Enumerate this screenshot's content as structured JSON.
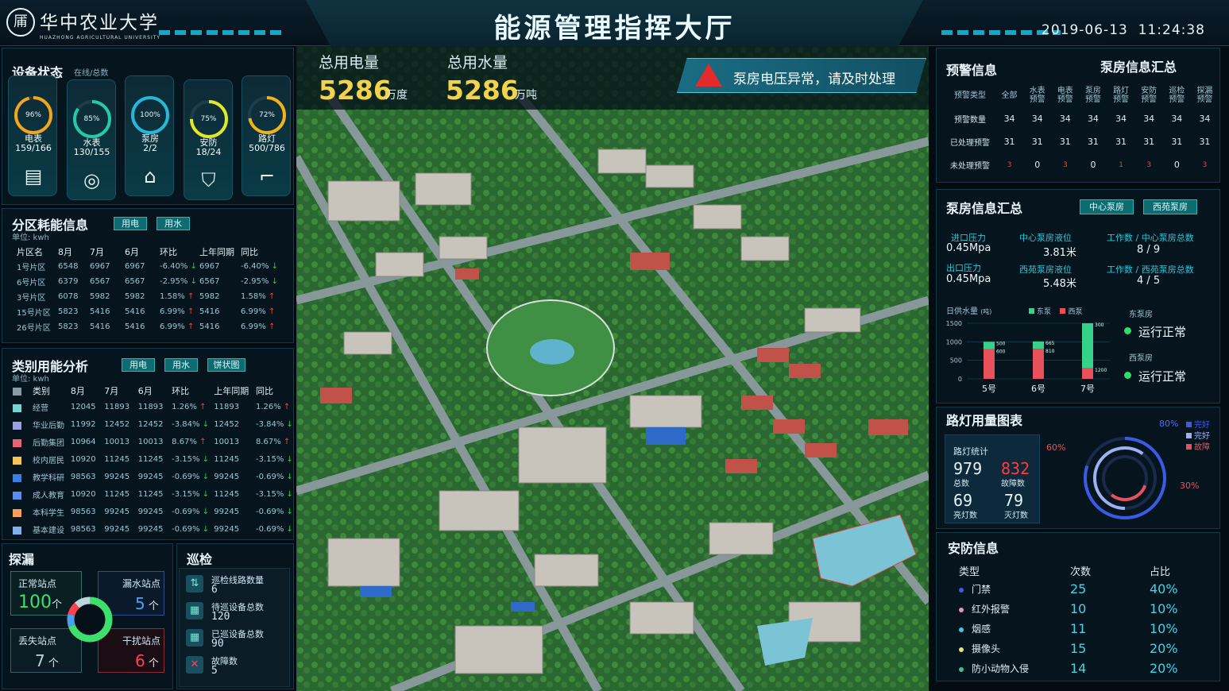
{
  "header": {
    "logo_glyph": "㕊",
    "logo_text": "华中农业大学",
    "logo_sub": "HUAZHONG AGRICULTURAL UNIVERSITY",
    "title": "能源管理指挥大厅",
    "date": "2019-06-13",
    "time": "11:24:38"
  },
  "device_status": {
    "title": "设备状态",
    "subtitle": "在线/总数",
    "items": [
      {
        "name": "电表",
        "pct": "96%",
        "count": "159/166",
        "level": 0.96,
        "color": "#f3a51d",
        "icon": "meter-icon",
        "glyph": "▤"
      },
      {
        "name": "水表",
        "pct": "85%",
        "count": "130/155",
        "level": 0.85,
        "color": "#26c9a8",
        "icon": "water-meter-icon",
        "glyph": "◎"
      },
      {
        "name": "泵房",
        "pct": "100%",
        "count": "2/2",
        "level": 1.0,
        "color": "#29b7d9",
        "icon": "house-icon",
        "glyph": "⌂"
      },
      {
        "name": "安防",
        "pct": "75%",
        "count": "18/24",
        "level": 0.75,
        "color": "#e2e72a",
        "icon": "shield-icon",
        "glyph": "⛉"
      },
      {
        "name": "路灯",
        "pct": "72%",
        "count": "500/786",
        "level": 0.72,
        "color": "#f1b21b",
        "icon": "streetlight-icon",
        "glyph": "⌐"
      }
    ]
  },
  "zone": {
    "title": "分区耗能信息",
    "unit": "单位: kwh",
    "tabs": [
      "用电",
      "用水"
    ],
    "headers": [
      "片区名",
      "8月",
      "7月",
      "6月",
      "环比",
      "上年同期",
      "同比"
    ],
    "rows": [
      [
        "1号片区",
        "6548",
        "6967",
        "6967",
        "-6.40%",
        "6967",
        "-6.40%",
        "dn",
        "dn"
      ],
      [
        "6号片区",
        "6379",
        "6567",
        "6567",
        "-2.95%",
        "6567",
        "-2.95%",
        "dn",
        "dn"
      ],
      [
        "3号片区",
        "6078",
        "5982",
        "5982",
        "1.58%",
        "5982",
        "1.58%",
        "up",
        "up"
      ],
      [
        "15号片区",
        "5823",
        "5416",
        "5416",
        "6.99%",
        "5416",
        "6.99%",
        "up",
        "up"
      ],
      [
        "26号片区",
        "5823",
        "5416",
        "5416",
        "6.99%",
        "5416",
        "6.99%",
        "up",
        "up"
      ]
    ]
  },
  "category": {
    "title": "类别用能分析",
    "unit": "单位: kwh",
    "tabs": [
      "用电",
      "用水",
      "饼状图"
    ],
    "headers": [
      "类别",
      "8月",
      "7月",
      "6月",
      "环比",
      "上年同期",
      "同比"
    ],
    "rows": [
      [
        "经营",
        "12045",
        "11893",
        "11893",
        "1.26%",
        "11893",
        "1.26%",
        "up",
        "#79d4d0"
      ],
      [
        "华业后勤",
        "11992",
        "12452",
        "12452",
        "-3.84%",
        "12452",
        "-3.84%",
        "dn",
        "#9aa2e0"
      ],
      [
        "后勤集团",
        "10964",
        "10013",
        "10013",
        "8.67%",
        "10013",
        "8.67%",
        "up",
        "#e2657a"
      ],
      [
        "校内居民",
        "10920",
        "11245",
        "11245",
        "-3.15%",
        "11245",
        "-3.15%",
        "dn",
        "#f2c45a"
      ],
      [
        "教学科研",
        "98563",
        "99245",
        "99245",
        "-0.69%",
        "99245",
        "-0.69%",
        "dn",
        "#3b7fe0"
      ],
      [
        "成人教育",
        "10920",
        "11245",
        "11245",
        "-3.15%",
        "11245",
        "-3.15%",
        "dn",
        "#5a8ce8"
      ],
      [
        "本科学生",
        "98563",
        "99245",
        "99245",
        "-0.69%",
        "99245",
        "-0.69%",
        "dn",
        "#f3a05a"
      ],
      [
        "基本建设",
        "98563",
        "99245",
        "99245",
        "-0.69%",
        "99245",
        "-0.69%",
        "dn",
        "#7fb0e8"
      ]
    ]
  },
  "leak": {
    "title": "探漏",
    "normal_label": "正常站点",
    "normal_val": "100",
    "leak_label": "漏水站点",
    "leak_val": "5",
    "lost_label": "丢失站点",
    "lost_val": "7",
    "interfere_label": "干扰站点",
    "interfere_val": "6",
    "unit": "个"
  },
  "patrol": {
    "title": "巡检",
    "items": [
      {
        "label": "巡检线路数量",
        "val": "6",
        "icon": "route-icon"
      },
      {
        "label": "待巡设备总数",
        "val": "120",
        "icon": "pending-device-icon"
      },
      {
        "label": "已巡设备总数",
        "val": "90",
        "icon": "done-device-icon"
      },
      {
        "label": "故障数",
        "val": "5",
        "icon": "fault-icon"
      }
    ]
  },
  "kpi": {
    "elec_label": "总用电量",
    "elec_val": "5286",
    "elec_unit": "万度",
    "water_label": "总用水量",
    "water_val": "5286",
    "water_unit": "万吨"
  },
  "alert": {
    "text": "泵房电压异常，请及时处理"
  },
  "warning": {
    "title": "预警信息",
    "title2": "泵房信息汇总",
    "cols": [
      "预警类型",
      "全部",
      "水表\n预警",
      "电表\n预警",
      "泵房\n预警",
      "路灯\n预警",
      "安防\n预警",
      "巡检\n预警",
      "探漏\n预警"
    ],
    "rows": [
      [
        "预警数量",
        "34",
        "34",
        "34",
        "34",
        "34",
        "34",
        "34",
        "34"
      ],
      [
        "已处理预警",
        "31",
        "31",
        "31",
        "31",
        "31",
        "31",
        "31",
        "31"
      ],
      [
        "未处理预警",
        "3",
        "0",
        "3",
        "0",
        "1",
        "3",
        "0",
        "3"
      ]
    ]
  },
  "pump": {
    "title": "泵房信息汇总",
    "tabs": [
      "中心泵房",
      "西苑泵房"
    ],
    "in_label": "进口压力",
    "in_val": "0.45Mpa",
    "out_label": "出口压力",
    "out_val": "0.45Mpa",
    "c_level_label": "中心泵房液位",
    "c_level_val": "3.81米",
    "w_level_label": "西苑泵房液位",
    "w_level_val": "5.48米",
    "c_work_label": "工作数 / 中心泵房总数",
    "c_work_val": "8 / 9",
    "w_work_label": "工作数 / 西苑泵房总数",
    "w_work_val": "4 / 5",
    "east_label": "东泵房",
    "east_status": "运行正常",
    "west_label": "西泵房",
    "west_status": "运行正常"
  },
  "chart_data": {
    "type": "bar",
    "title": "日供水量",
    "unit": "(吨)",
    "categories": [
      "5号",
      "6号",
      "7号"
    ],
    "series": [
      {
        "name": "东泵",
        "color": "#35d38a",
        "values": [
          200,
          200,
          1200
        ]
      },
      {
        "name": "西泵",
        "color": "#e8505c",
        "values": [
          800,
          810,
          300
        ]
      }
    ],
    "labels_top": [
      "500",
      "665",
      "300"
    ],
    "labels_mid": [
      "600",
      "810",
      "1200"
    ],
    "ylim": [
      0,
      1500
    ],
    "yticks": [
      "1500",
      "1000",
      "500",
      "0"
    ]
  },
  "streetlight": {
    "title": "路灯用量图表",
    "box_title": "路灯统计",
    "total_val": "979",
    "total_label": "总数",
    "fault_val": "832",
    "fault_label": "故障数",
    "on_val": "69",
    "on_label": "亮灯数",
    "off_val": "79",
    "off_label": "灭灯数",
    "legend": [
      {
        "label": "完好",
        "color": "#3a5be6"
      },
      {
        "label": "完好",
        "color": "#9fb0f0"
      },
      {
        "label": "故障",
        "color": "#e8505c"
      }
    ],
    "pct_a": "80%",
    "pct_b": "60%",
    "pct_c": "30%",
    "ring_a": 0.8,
    "ring_b": 0.6,
    "ring_c": 0.3
  },
  "security": {
    "title": "安防信息",
    "headers": [
      "类型",
      "次数",
      "占比"
    ],
    "rows": [
      {
        "type": "门禁",
        "count": "25",
        "pct": "40%",
        "color": "#3a5be6"
      },
      {
        "type": "红外报警",
        "count": "10",
        "pct": "10%",
        "color": "#e68fc6"
      },
      {
        "type": "烟感",
        "count": "11",
        "pct": "10%",
        "color": "#3fc8e0"
      },
      {
        "type": "摄像头",
        "count": "15",
        "pct": "20%",
        "color": "#e6e37a"
      },
      {
        "type": "防小动物入侵",
        "count": "14",
        "pct": "20%",
        "color": "#3fc090"
      }
    ]
  }
}
